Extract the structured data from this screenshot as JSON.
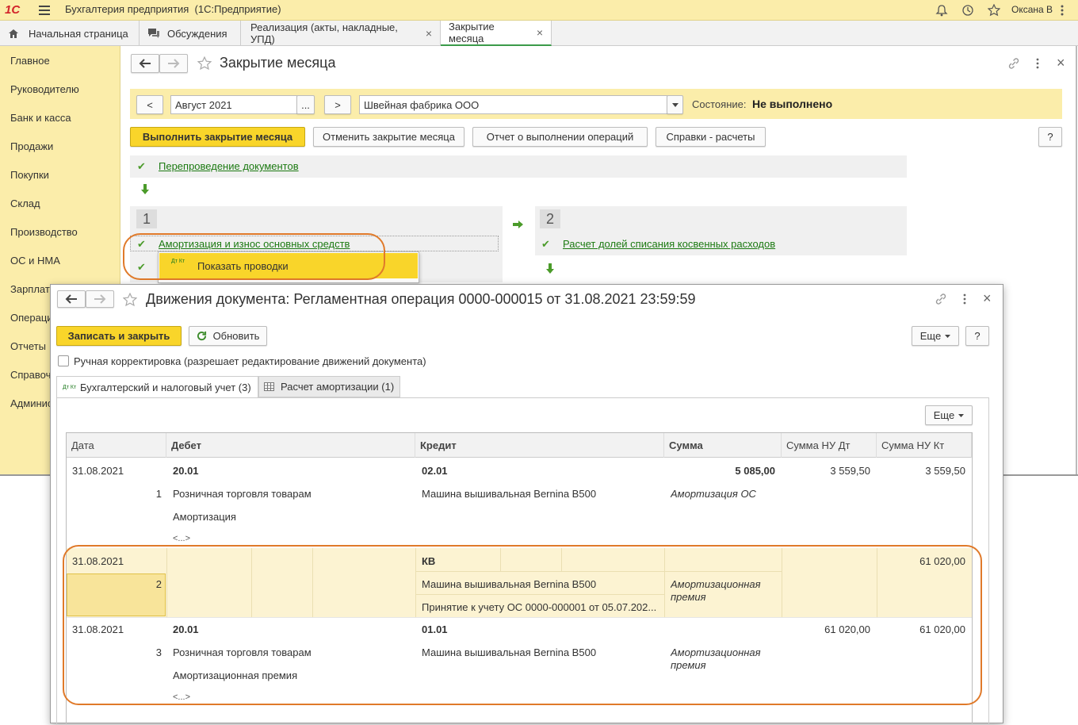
{
  "app": {
    "title": "Бухгалтерия предприятия  (1С:Предприятие)",
    "user": "Оксана В",
    "logo_text": "1С"
  },
  "tabs": [
    {
      "label": "Начальная страница"
    },
    {
      "label": "Обсуждения"
    },
    {
      "label": "Реализация (акты, накладные, УПД)"
    },
    {
      "label": "Закрытие месяца"
    }
  ],
  "sidebar": {
    "items": [
      "Главное",
      "Руководителю",
      "Банк и касса",
      "Продажи",
      "Покупки",
      "Склад",
      "Производство",
      "ОС и НМА",
      "Зарплата",
      "Операции",
      "Отчеты",
      "Справочники",
      "Администрирование"
    ]
  },
  "main": {
    "title": "Закрытие месяца",
    "period_prev": "<",
    "period": "Август 2021",
    "period_more": "...",
    "period_next": ">",
    "org": "Швейная фабрика ООО",
    "status_label": "Состояние:",
    "status_value": "Не выполнено",
    "btn_run": "Выполнить закрытие месяца",
    "btn_cancel": "Отменить закрытие месяца",
    "btn_report": "Отчет о выполнении операций",
    "btn_calc": "Справки - расчеты",
    "btn_help": "?",
    "repost": "Перепроведение документов",
    "step1_num": "1",
    "step1_item": "Амортизация и износ основных средств",
    "step2_num": "2",
    "step2_item": "Расчет долей списания косвенных расходов",
    "popup_label": "Показать проводки",
    "popup_icon": "Дт Кт"
  },
  "dialog": {
    "title": "Движения документа: Регламентная операция 0000-000015 от 31.08.2021 23:59:59",
    "btn_save": "Записать и закрыть",
    "btn_refresh": "Обновить",
    "btn_more": "Еще",
    "btn_help": "?",
    "manual_label": "Ручная корректировка (разрешает редактирование движений документа)",
    "tab1": "Бухгалтерский и налоговый учет (3)",
    "tab2": "Расчет амортизации (1)",
    "tab1_icon": "Дт Кт",
    "table_more": "Еще",
    "columns": [
      "Дата",
      "Дебет",
      "Кредит",
      "Сумма",
      "Сумма НУ Дт",
      "Сумма НУ Кт"
    ],
    "rows": [
      {
        "date": "31.08.2021",
        "num": "1",
        "debit": "20.01",
        "debit_sub1": "Розничная торговля товарам",
        "debit_sub2": "Амортизация",
        "debit_sub3": "<...>",
        "credit": "02.01",
        "credit_sub1": "Машина вышивальная Bernina B500",
        "credit_sub2": "",
        "sum": "5 085,00",
        "sum_desc": "Амортизация ОС",
        "nu_dt": "3 559,50",
        "nu_kt": "3 559,50"
      },
      {
        "date": "31.08.2021",
        "num": "2",
        "debit": "",
        "debit_sub1": "",
        "debit_sub2": "",
        "debit_sub3": "",
        "credit": "КВ",
        "credit_sub1": "Машина вышивальная Bernina B500",
        "credit_sub2": "Принятие к учету ОС 0000-000001 от 05.07.202...",
        "sum": "",
        "sum_desc": "Амортизационная премия",
        "nu_dt": "",
        "nu_kt": "61 020,00"
      },
      {
        "date": "31.08.2021",
        "num": "3",
        "debit": "20.01",
        "debit_sub1": "Розничная торговля товарам",
        "debit_sub2": "Амортизационная премия",
        "debit_sub3": "<...>",
        "credit": "01.01",
        "credit_sub1": "Машина вышивальная Bernina B500",
        "credit_sub2": "",
        "sum": "",
        "sum_desc": "Амортизационная премия",
        "nu_dt": "61 020,00",
        "nu_kt": "61 020,00"
      }
    ]
  },
  "colors": {
    "accent_yellow": "#f9d52a",
    "highlight_row": "#fcf3d2",
    "link_green": "#1c7a12",
    "annotation_orange": "#e07a2a"
  }
}
